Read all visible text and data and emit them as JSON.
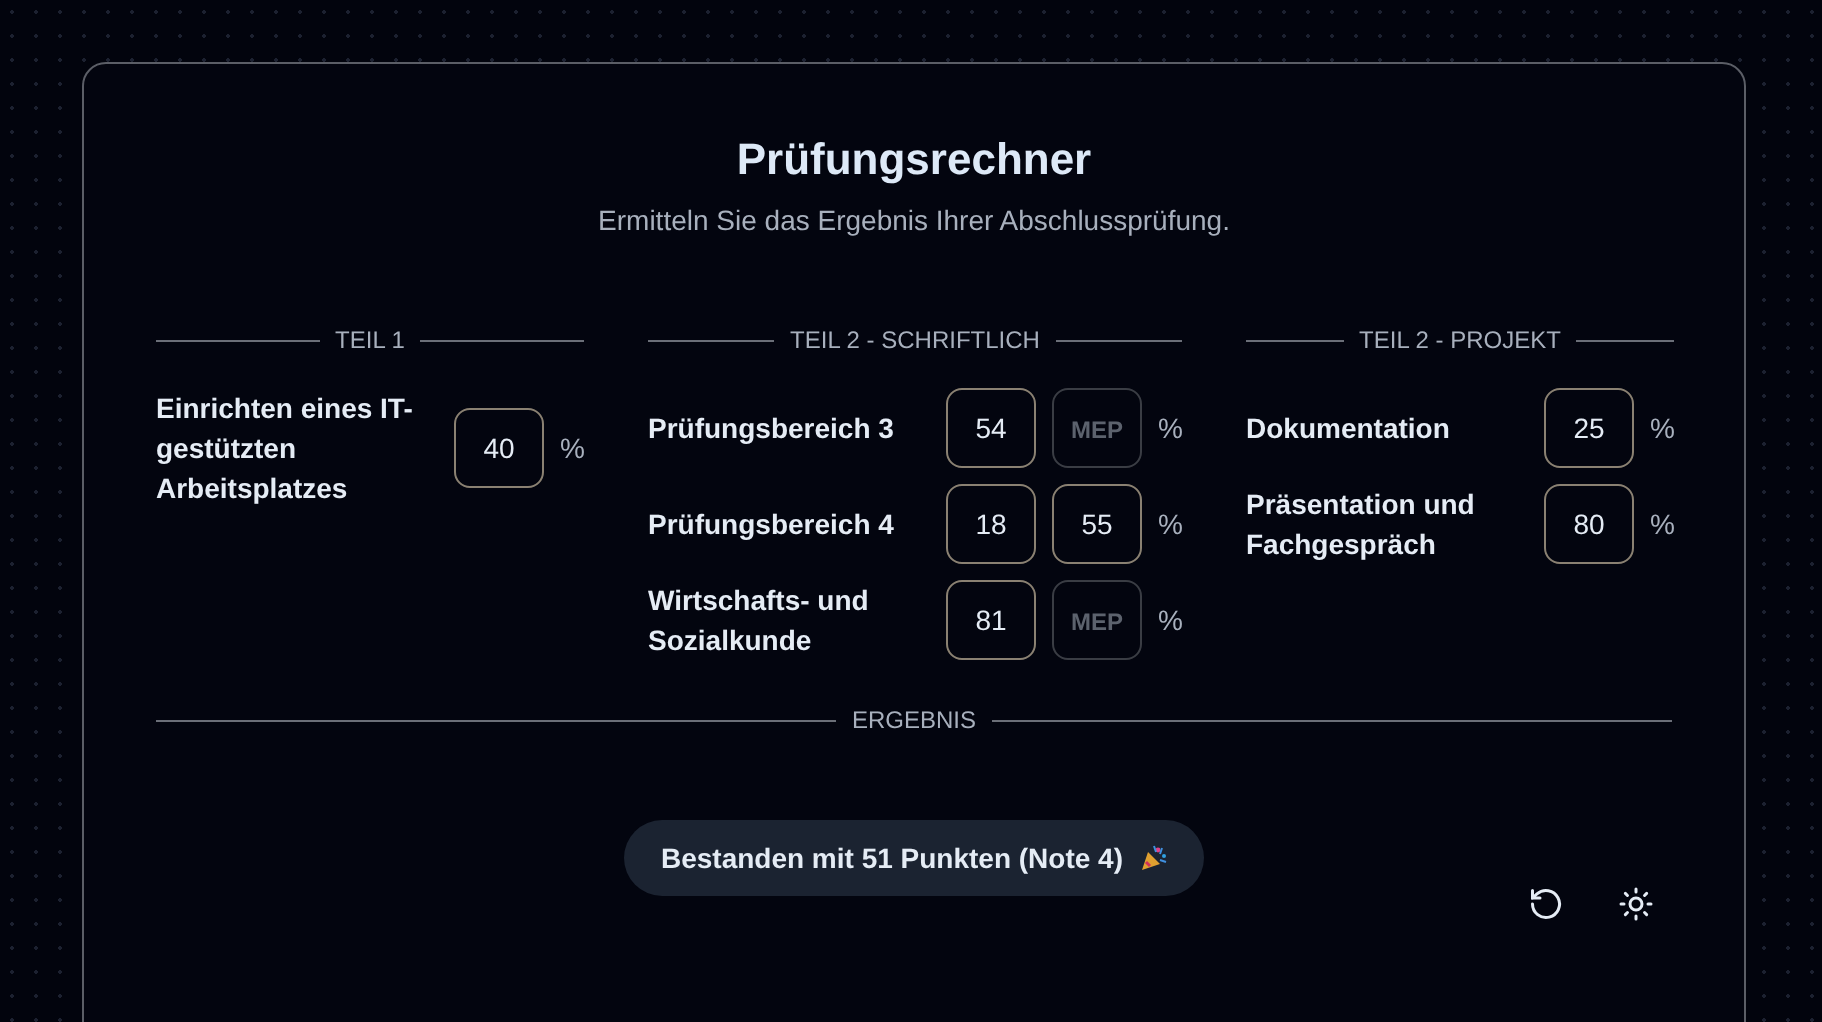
{
  "title": "Prüfungsrechner",
  "subtitle": "Ermitteln Sie das Ergebnis Ihrer Abschlussprüfung.",
  "sections": [
    {
      "heading": "TEIL 1",
      "rows": [
        {
          "label": "Einrichten eines IT-gestützten Arbeitsplatzes",
          "fields": [
            {
              "value": "40"
            }
          ],
          "unit": "%"
        }
      ]
    },
    {
      "heading": "TEIL 2 - SCHRIFTLICH",
      "rows": [
        {
          "label": "Prüfungsbereich 3",
          "fields": [
            {
              "value": "54"
            },
            {
              "placeholder": "MEP"
            }
          ],
          "unit": "%"
        },
        {
          "label": "Prüfungsbereich 4",
          "fields": [
            {
              "value": "18"
            },
            {
              "value": "55"
            }
          ],
          "unit": "%"
        },
        {
          "label": "Wirtschafts- und Sozialkunde",
          "fields": [
            {
              "value": "81"
            },
            {
              "placeholder": "MEP"
            }
          ],
          "unit": "%"
        }
      ]
    },
    {
      "heading": "TEIL 2 - PROJEKT",
      "rows": [
        {
          "label": "Dokumentation",
          "fields": [
            {
              "value": "25"
            }
          ],
          "unit": "%"
        },
        {
          "label": "Präsentation und Fachgespräch",
          "fields": [
            {
              "value": "80"
            }
          ],
          "unit": "%"
        }
      ]
    }
  ],
  "result_heading": "ERGEBNIS",
  "result": "Bestanden mit 51 Punkten (Note 4)"
}
